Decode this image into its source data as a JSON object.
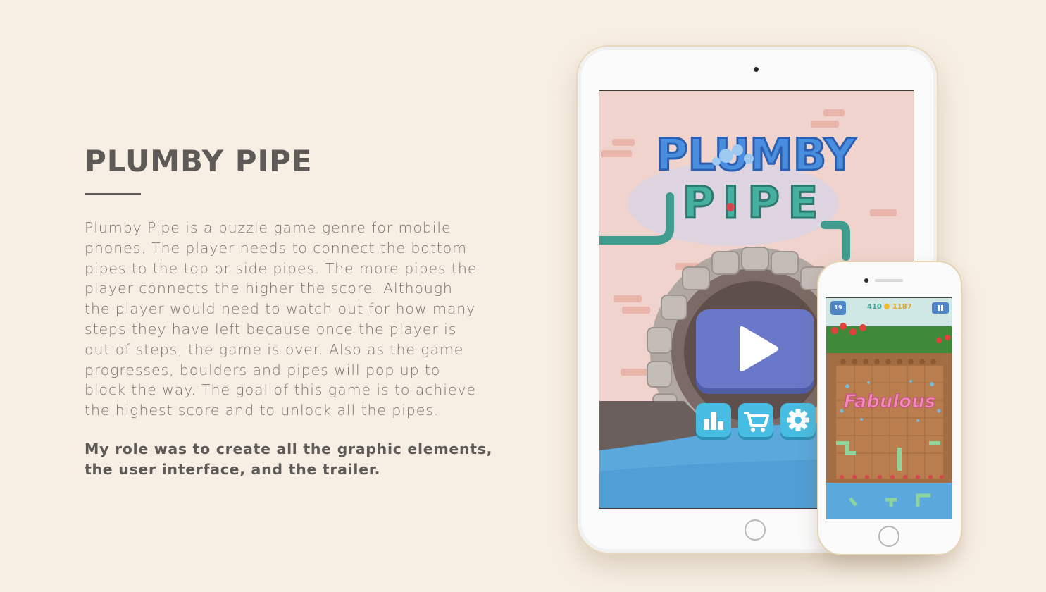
{
  "heading": {
    "title": "PLUMBY PIPE"
  },
  "description": {
    "lines": [
      "Plumby Pipe is a puzzle game genre for mobile",
      "phones. The player needs to connect the bottom",
      "pipes to the top or side pipes. The more pipes the",
      "player connects the higher the score. Although",
      "the player would need to watch out for how many",
      "steps they have left because once the player is",
      "out of steps, the game is over. Also as the game",
      "progresses, boulders and pipes will pop up to",
      "block the way. The goal of this game is to achieve",
      "the highest score and to unlock all the pipes."
    ]
  },
  "role": {
    "lines": [
      "My role was to create all the graphic elements,",
      "the user interface, and the trailer."
    ]
  },
  "tablet_game": {
    "logo_top": "PLUMBY",
    "logo_bottom": "PIPE",
    "play_icon": "play-icon",
    "buttons": [
      "leaderboard-icon",
      "cart-icon",
      "gear-icon"
    ]
  },
  "phone_game": {
    "level": "19",
    "moves": "410",
    "score": "1187",
    "banner": "Fabulous",
    "pause_icon": "pause-icon",
    "medal_icon": "medal-icon"
  },
  "colors": {
    "background": "#f8efe4",
    "title": "#5d5a57",
    "body_text": "#7a7672",
    "play_button": "#6a78c9",
    "menu_button": "#48bde3",
    "water": "#5aa8dc",
    "pipe_teal": "#3f9c8f",
    "logo_blue": "#4a8ee0"
  }
}
